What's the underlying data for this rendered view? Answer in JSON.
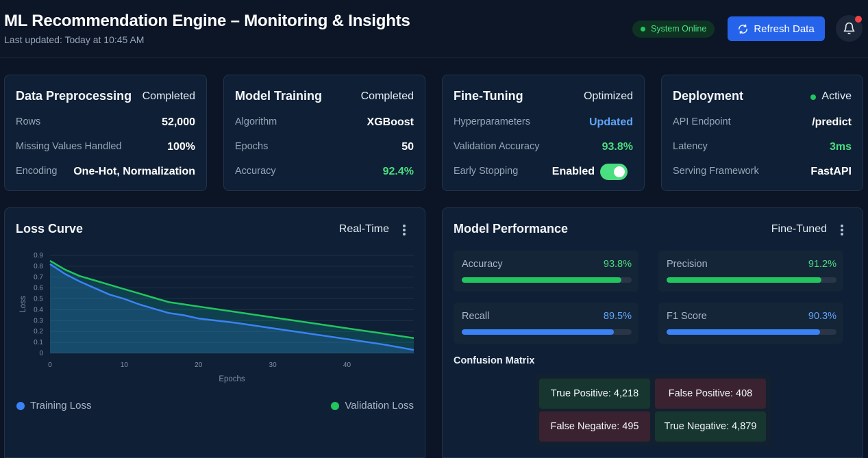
{
  "header": {
    "title": "ML Recommendation Engine – Monitoring & Insights",
    "subtitle": "Last updated: Today at 10:45 AM",
    "status": "System Online",
    "refresh_label": "Refresh Data",
    "has_notification": true
  },
  "cards": {
    "preprocessing": {
      "title": "Data Preprocessing",
      "status": "Completed",
      "rows": [
        {
          "label": "Rows",
          "value": "52,000"
        },
        {
          "label": "Missing Values Handled",
          "value": "100%"
        },
        {
          "label": "Encoding",
          "value": "One-Hot, Normalization"
        }
      ]
    },
    "training": {
      "title": "Model Training",
      "status": "Completed",
      "rows": [
        {
          "label": "Algorithm",
          "value": "XGBoost"
        },
        {
          "label": "Epochs",
          "value": "50"
        },
        {
          "label": "Accuracy",
          "value": "92.4%"
        }
      ]
    },
    "finetuning": {
      "title": "Fine-Tuning",
      "status": "Optimized",
      "rows": [
        {
          "label": "Hyperparameters",
          "value": "Updated"
        },
        {
          "label": "Validation Accuracy",
          "value": "93.8%"
        },
        {
          "label": "Early Stopping",
          "value": "Enabled"
        }
      ],
      "early_stopping_on": true
    },
    "deployment": {
      "title": "Deployment",
      "status": "Active",
      "rows": [
        {
          "label": "API Endpoint",
          "value": "/predict"
        },
        {
          "label": "Latency",
          "value": "3ms"
        },
        {
          "label": "Serving Framework",
          "value": "FastAPI"
        }
      ]
    }
  },
  "loss_panel": {
    "title": "Loss Curve",
    "mode": "Real-Time",
    "legend": [
      "Training Loss",
      "Validation Loss"
    ]
  },
  "performance_panel": {
    "title": "Model Performance",
    "mode": "Fine-Tuned",
    "metrics": [
      {
        "label": "Accuracy",
        "value": "93.8%",
        "fraction": 0.938,
        "color": "#22c55e"
      },
      {
        "label": "Precision",
        "value": "91.2%",
        "fraction": 0.912,
        "color": "#22c55e"
      },
      {
        "label": "Recall",
        "value": "89.5%",
        "fraction": 0.895,
        "color": "#3b82f6"
      },
      {
        "label": "F1 Score",
        "value": "90.3%",
        "fraction": 0.903,
        "color": "#3b82f6"
      }
    ],
    "confusion_title": "Confusion Matrix",
    "confusion": {
      "tp": "True Positive: 4,218",
      "fp": "False Positive: 408",
      "fn": "False Negative: 495",
      "tn": "True Negative: 4,879"
    }
  },
  "colors": {
    "accent": "#2563eb",
    "success": "#4ade80",
    "info": "#60a5fa",
    "training_line": "#3b82f6",
    "validation_line": "#22c55e"
  },
  "chart_data": {
    "type": "line",
    "title": "",
    "xlabel": "Epochs",
    "ylabel": "Loss",
    "xlim": [
      0,
      49
    ],
    "ylim": [
      0,
      0.9
    ],
    "xticks": [
      0,
      10,
      20,
      30,
      40
    ],
    "yticks": [
      0,
      0.1,
      0.2,
      0.3,
      0.4,
      0.5,
      0.6,
      0.7,
      0.8,
      0.9
    ],
    "grid": true,
    "legend_position": "bottom",
    "x": [
      0,
      2,
      4,
      6,
      8,
      10,
      12,
      14,
      16,
      18,
      20,
      25,
      30,
      35,
      40,
      45,
      49
    ],
    "series": [
      {
        "name": "Training Loss",
        "values": [
          0.82,
          0.73,
          0.66,
          0.6,
          0.54,
          0.5,
          0.45,
          0.41,
          0.37,
          0.35,
          0.32,
          0.28,
          0.23,
          0.18,
          0.13,
          0.08,
          0.03
        ]
      },
      {
        "name": "Validation Loss",
        "values": [
          0.85,
          0.77,
          0.71,
          0.67,
          0.63,
          0.59,
          0.55,
          0.51,
          0.47,
          0.45,
          0.43,
          0.38,
          0.33,
          0.28,
          0.23,
          0.18,
          0.14
        ]
      }
    ]
  }
}
